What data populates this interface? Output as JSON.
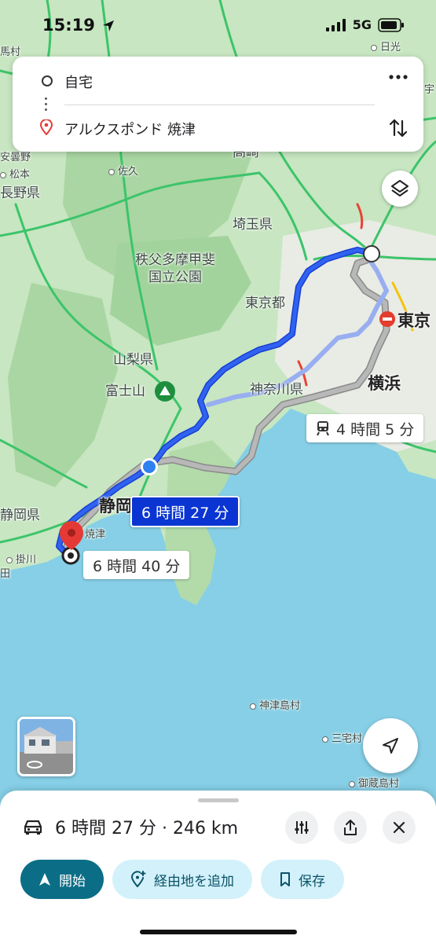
{
  "status_bar": {
    "time": "15:19",
    "network": "5G"
  },
  "route": {
    "origin": "自宅",
    "destination": "アルクスポンド 焼津"
  },
  "map": {
    "labels": {
      "gunma": "馬村",
      "nikko": "日光",
      "u": "宇",
      "takasaki": "高崎",
      "azumino": "安曇野",
      "matsumoto": "松本",
      "nagano": "長野県",
      "saku": "佐久",
      "saitama": "埼玉県",
      "park": "秩父多摩甲斐\n国立公園",
      "tokyo_to": "東京都",
      "tokyo": "東京",
      "yamanashi": "山梨県",
      "fuji": "富士山",
      "kanagawa": "神奈川県",
      "yokohama": "横浜",
      "shizuoka": "静岡",
      "shizuoka_pref": "静岡県",
      "yaizu": "焼津",
      "kakegawa": "掛川",
      "ta": "田",
      "kozushima": "神津島村",
      "miyake": "三宅村",
      "mikura": "御蔵島村"
    },
    "route_labels": {
      "selected": "6 時間 27 分",
      "alternate": "6 時間 40 分",
      "transit": "4 時間 5 分"
    }
  },
  "sheet": {
    "summary": "6 時間 27 分 · 246 km",
    "start_label": "開始",
    "add_stop_label": "経由地を追加",
    "save_label": "保存"
  }
}
